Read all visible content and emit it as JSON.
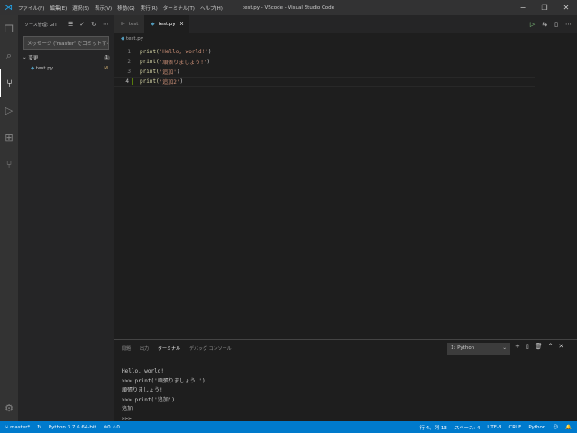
{
  "window": {
    "title": "test.py - VScode - Visual Studio Code",
    "menu": [
      "ファイル(F)",
      "編集(E)",
      "選択(S)",
      "表示(V)",
      "移動(G)",
      "実行(R)",
      "ターミナル(T)",
      "ヘルプ(H)"
    ]
  },
  "sidebar": {
    "title": "ソース管理: GIT",
    "message_placeholder": "メッセージ ('master' でコミットするための ...",
    "group": "変更",
    "group_count": "1",
    "file": "test.py",
    "file_status": "M"
  },
  "tabs": [
    {
      "label": "test"
    },
    {
      "label": "test.py",
      "close": "X"
    }
  ],
  "breadcrumb": "test.py",
  "code": [
    {
      "n": "1",
      "pre": "print(",
      "s": "'Hello, world!'",
      "post": ")"
    },
    {
      "n": "2",
      "pre": "print(",
      "s": "'頑張りましょう!'",
      "post": ")"
    },
    {
      "n": "3",
      "pre": "print(",
      "s": "'追加'",
      "post": ")"
    },
    {
      "n": "4",
      "pre": "print(",
      "s": "'追加2'",
      "post": ")"
    }
  ],
  "panel": {
    "tabs": [
      "問題",
      "出力",
      "ターミナル",
      "デバッグ コンソール"
    ],
    "terminal_select": "1: Python",
    "terminal_lines": [
      "Hello, world!",
      ">>> print('頑張りましょう!')",
      "頑張りましょう!",
      ">>> print('追加')",
      "追加",
      ">>>"
    ]
  },
  "status": {
    "branch": "master*",
    "python": "Python 3.7.6 64-bit",
    "errors": "0",
    "warnings": "0",
    "position": "行 4、列 13",
    "spaces": "スペース: 4",
    "encoding": "UTF-8",
    "eol": "CRLF",
    "language": "Python"
  },
  "colors": {
    "status_bar": "#007acc",
    "accent_gutter": "#587c0c"
  }
}
